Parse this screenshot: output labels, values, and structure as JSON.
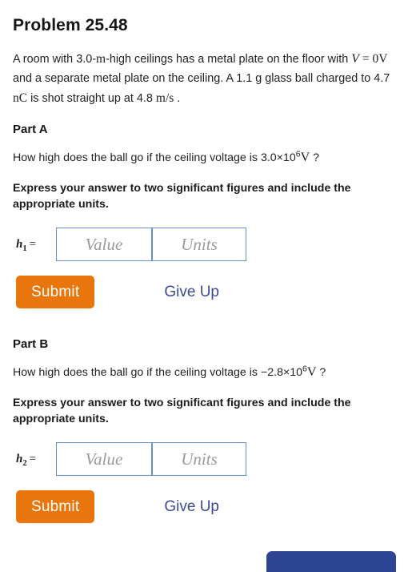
{
  "problem": {
    "title": "Problem 25.48",
    "statement": {
      "seg1": "A room with ",
      "val_height": "3.0-",
      "unit_m": "m",
      "seg2": "-high ceilings has a metal plate on the floor with ",
      "math_v": "V",
      "math_eq": " = 0",
      "math_v_unit": "V",
      "seg3": " and a separate metal plate on the ceiling. A 1.1 g glass ball charged to 4.7 ",
      "unit_nc": "nC",
      "seg4": " is shot straight up at 4.8 ",
      "unit_ms": "m/s",
      "seg5": " ."
    }
  },
  "parts": [
    {
      "heading": "Part A",
      "question_prefix": "How high does the ball go if the ceiling voltage is ",
      "question_mantissa": "3.0×10",
      "question_exponent": "6",
      "question_unit": "V",
      "question_suffix": " ?",
      "instruction": "Express your answer to two significant figures and include the appropriate units.",
      "answer_symbol": "h",
      "answer_subscript": "1",
      "answer_equals": "=",
      "value_placeholder": "Value",
      "units_placeholder": "Units",
      "submit_label": "Submit",
      "giveup_label": "Give Up"
    },
    {
      "heading": "Part B",
      "question_prefix": "How high does the ball go if the ceiling voltage is ",
      "question_mantissa": "−2.8×10",
      "question_exponent": "6",
      "question_unit": "V",
      "question_suffix": " ?",
      "instruction": "Express your answer to two significant figures and include the appropriate units.",
      "answer_symbol": "h",
      "answer_subscript": "2",
      "answer_equals": "=",
      "value_placeholder": "Value",
      "units_placeholder": "Units",
      "submit_label": "Submit",
      "giveup_label": "Give Up"
    }
  ],
  "colors": {
    "submit_orange": "#e8760c",
    "link_navy": "#3b4a94",
    "field_border_blue": "#6a8ec6",
    "bottom_button_blue": "#2e4593",
    "text_black": "#1c1c1c"
  }
}
